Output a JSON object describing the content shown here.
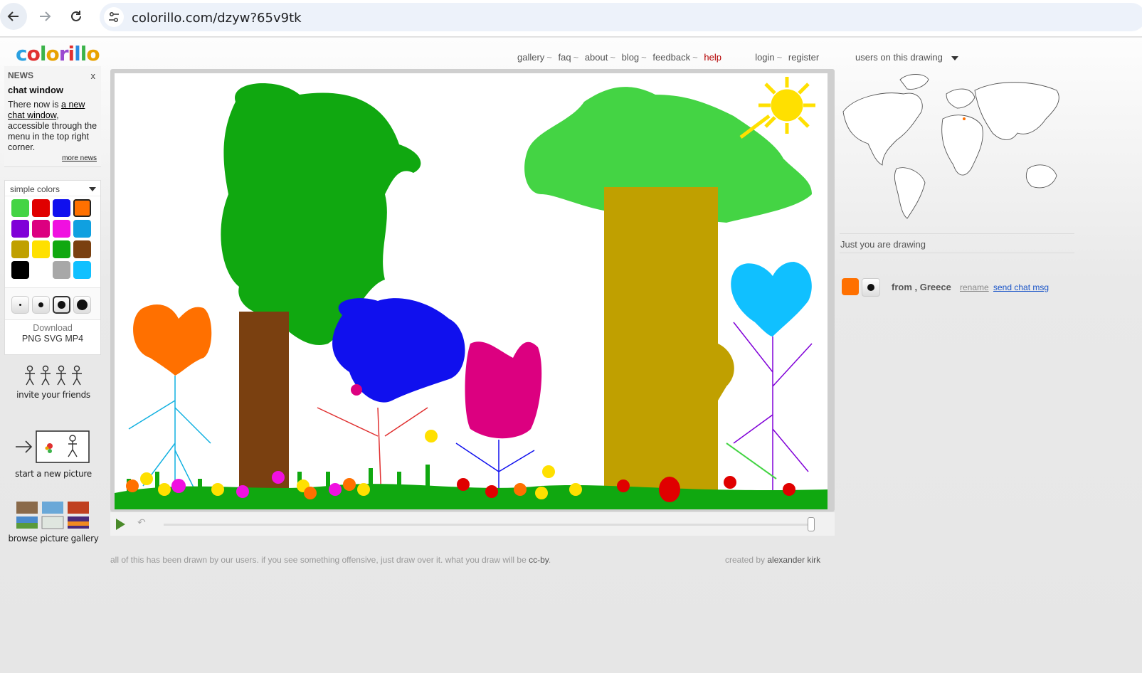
{
  "browser": {
    "url": "colorillo.com/dzyw?65v9tk"
  },
  "logo": {
    "letters": [
      "c",
      "o",
      "l",
      "o",
      "r",
      "i",
      "l",
      "l",
      "o"
    ],
    "colors": [
      "#2aa0e0",
      "#e03030",
      "#3cb34a",
      "#e8a200",
      "#9a4ad0",
      "#e03030",
      "#2a8ae0",
      "#3cb34a",
      "#e8a200"
    ]
  },
  "topnav": {
    "gallery": "gallery",
    "faq": "faq",
    "about": "about",
    "blog": "blog",
    "feedback": "feedback",
    "help": "help",
    "login": "login",
    "register": "register",
    "sep": "~",
    "users_dropdown": "users on this drawing"
  },
  "news": {
    "heading": "NEWS",
    "close": "x",
    "title": "chat window",
    "body_pre": "There now is ",
    "body_link": "a new chat window",
    "body_post": ", accessible through the menu in the top right corner.",
    "more": "more news"
  },
  "palette": {
    "mode": "simple colors",
    "colors": [
      "#44d444",
      "#e00000",
      "#1010ee",
      "#ff7000",
      "#8000d8",
      "#dc0080",
      "#f010e0",
      "#10a0e0",
      "#c0a000",
      "#ffe000",
      "#10a810",
      "#7a4010",
      "#000000",
      "#ffffff",
      "#a8a8a8",
      "#10c0ff"
    ],
    "selected_color": "#ff7000",
    "brush_sizes": [
      3,
      7,
      11,
      15
    ],
    "selected_brush": 11,
    "download_label": "Download",
    "download_formats": "PNG SVG MP4"
  },
  "tools": {
    "invite": "invite your friends",
    "new_picture": "start a new picture",
    "gallery": "browse picture gallery"
  },
  "player": {
    "undo": "↶"
  },
  "footer": {
    "left": "all of this has been drawn by our users. if you see something offensive, just draw over it. what you draw will be ",
    "license": "cc-by",
    "period": ".",
    "created_by": "created by ",
    "author": "alexander kirk"
  },
  "sidebar": {
    "status": "Just you are drawing",
    "user": {
      "color": "#ff7000",
      "from": "from , Greece",
      "rename": "rename",
      "chat": "send chat msg"
    }
  }
}
